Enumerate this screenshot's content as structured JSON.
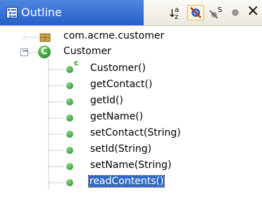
{
  "view": {
    "title": "Outline",
    "title_icon": "outline-view-icon",
    "accent": "#2c64cc"
  },
  "toolbar": {
    "sort": {
      "icon": "sort-alphabetically-icon",
      "glyph_main": "↓",
      "glyph_sup": "a",
      "glyph_sub": "z"
    },
    "hide_fields": {
      "icon": "hide-fields-icon"
    },
    "hide_static": {
      "icon": "hide-static-members-icon",
      "glyph_sup": "S"
    },
    "hide_nonpublic": {
      "icon": "hide-non-public-members-icon"
    },
    "close": {
      "icon": "close-icon",
      "glyph": "×"
    }
  },
  "tree": {
    "package": {
      "label": "com.acme.customer",
      "icon": "package-icon"
    },
    "class": {
      "label": "Customer",
      "icon": "public-class-icon",
      "glyph": "C",
      "expander": "−"
    },
    "members": [
      {
        "label": "Customer()",
        "icon": "constructor-icon",
        "constructor_mark": "c"
      },
      {
        "label": "getContact()",
        "icon": "public-method-icon"
      },
      {
        "label": "getId()",
        "icon": "public-method-icon"
      },
      {
        "label": "getName()",
        "icon": "public-method-icon"
      },
      {
        "label": "setContact(String)",
        "icon": "public-method-icon"
      },
      {
        "label": "setId(String)",
        "icon": "public-method-icon"
      },
      {
        "label": "setName(String)",
        "icon": "public-method-icon"
      },
      {
        "label": "readContents()",
        "icon": "public-method-icon"
      }
    ],
    "selected_member": "readContents()",
    "colors": {
      "method_green": "#2e9a2e",
      "selection": "#316ac5"
    }
  }
}
